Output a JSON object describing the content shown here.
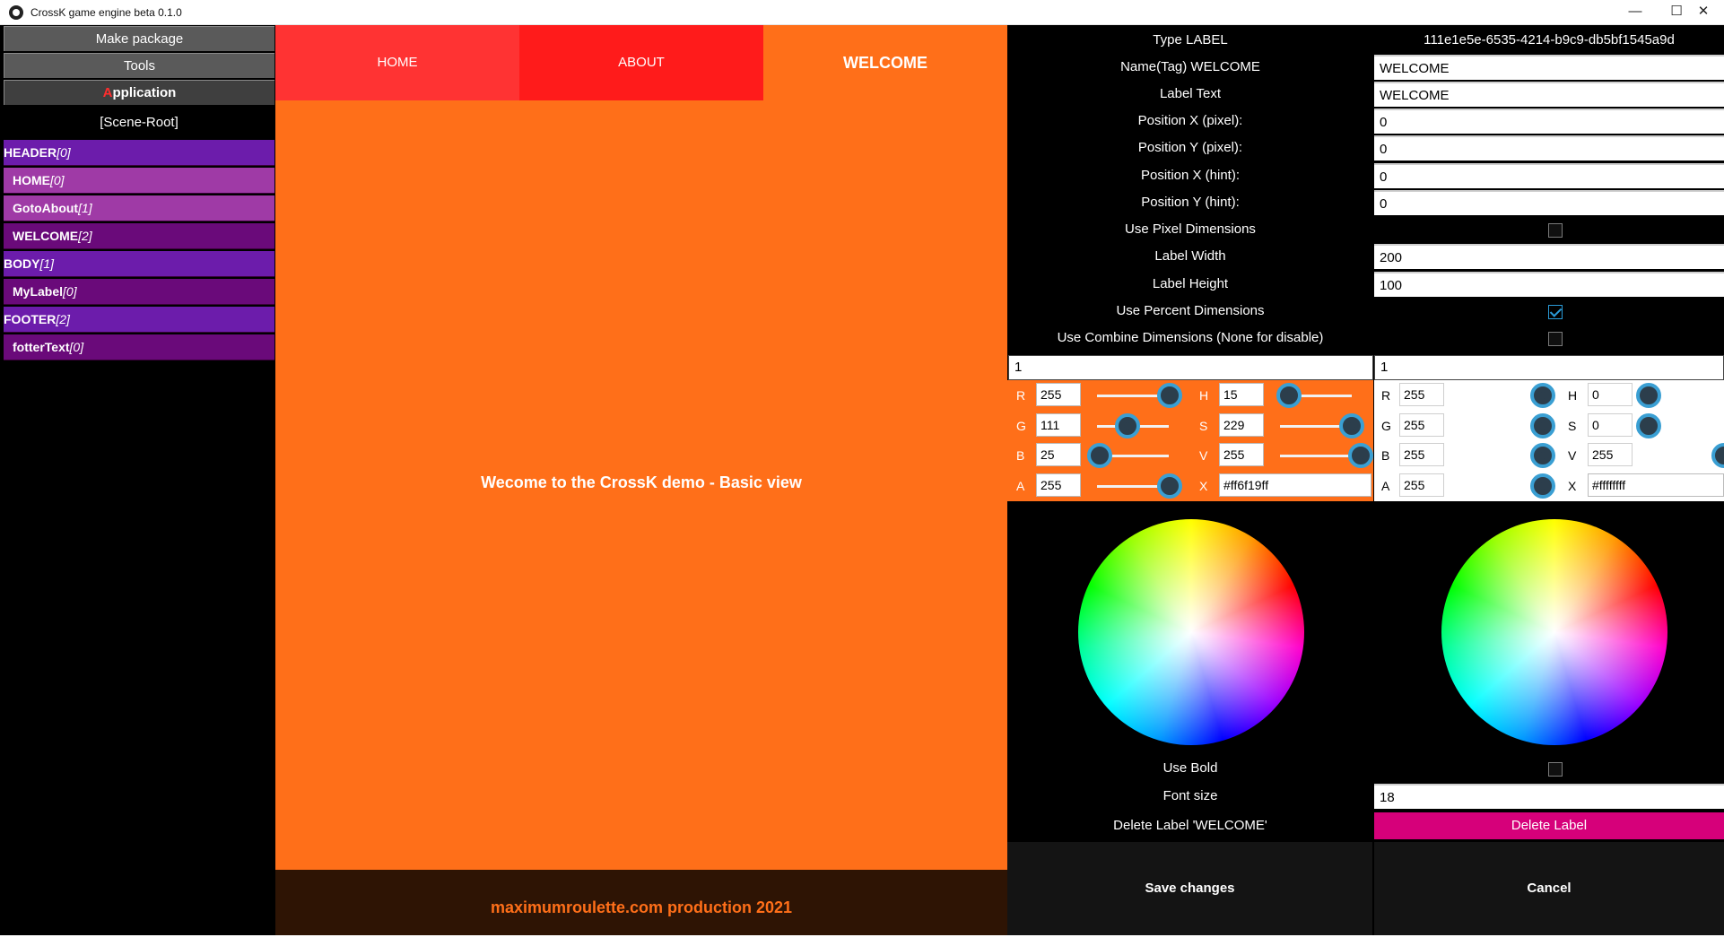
{
  "window": {
    "title": "CrossK game engine beta 0.1.0",
    "minimize": "—",
    "maximize": "☐",
    "close": "✕"
  },
  "sidebar": {
    "buttons": [
      {
        "label": "Make package"
      },
      {
        "label": "Tools"
      },
      {
        "accent": "A",
        "label": "pplication"
      }
    ],
    "scene_root": "[Scene-Root]",
    "tree": [
      {
        "name": "HEADER",
        "index": "[0]"
      },
      {
        "name": "HOME",
        "index": "[0]"
      },
      {
        "name": "GotoAbout",
        "index": "[1]"
      },
      {
        "name": "WELCOME",
        "index": "[2]"
      },
      {
        "name": "BODY",
        "index": "[1]"
      },
      {
        "name": "MyLabel",
        "index": "[0]"
      },
      {
        "name": "FOOTER",
        "index": "[2]"
      },
      {
        "name": "fotterText",
        "index": "[0]"
      }
    ]
  },
  "preview": {
    "nav": [
      "HOME",
      "ABOUT",
      "WELCOME"
    ],
    "body_text": "Wecome to the CrossK demo - Basic view",
    "footer_text": "maximumroulette.com production 2021",
    "background": "#ff6f19"
  },
  "panel": {
    "type_label": "Type LABEL",
    "type_value": "111e1e5e-6535-4214-b9c9-db5bf1545a9d",
    "name_tag_label": "Name(Tag) WELCOME",
    "name_tag_value": "WELCOME",
    "label_text_label": "Label Text",
    "label_text_value": "WELCOME",
    "pos_x_px_label": "Position X (pixel):",
    "pos_x_px_value": "0",
    "pos_y_px_label": "Position Y (pixel):",
    "pos_y_px_value": "0",
    "pos_x_hint_label": "Position X (hint):",
    "pos_x_hint_value": "0",
    "pos_y_hint_label": "Position Y (hint):",
    "pos_y_hint_value": "0",
    "use_pixel_dims_label": "Use Pixel Dimensions",
    "use_pixel_dims": false,
    "label_width_label": "Label Width",
    "label_width_value": "200",
    "label_height_label": "Label Height",
    "label_height_value": "100",
    "use_percent_dims_label": "Use Percent Dimensions",
    "use_percent_dims": true,
    "use_combine_dims_label": "Use Combine Dimensions (None for disable)",
    "use_combine_dims": false,
    "combine_left_value": "1",
    "combine_right_value": "1",
    "color_left": {
      "R": "255",
      "G": "111",
      "B": "25",
      "A": "255",
      "H": "15",
      "S": "229",
      "V": "255",
      "X": "#ff6f19ff"
    },
    "color_right": {
      "R": "255",
      "G": "255",
      "B": "255",
      "A": "255",
      "H": "0",
      "S": "0",
      "V": "255",
      "X": "#ffffffff"
    },
    "use_bold_label": "Use Bold",
    "use_bold": false,
    "font_size_label": "Font size",
    "font_size_value": "18",
    "delete_prompt": "Delete Label 'WELCOME'",
    "delete_button": "Delete Label",
    "save_button": "Save changes",
    "cancel_button": "Cancel"
  },
  "channel_letters": [
    "R",
    "G",
    "B",
    "A",
    "H",
    "S",
    "V",
    "X"
  ]
}
